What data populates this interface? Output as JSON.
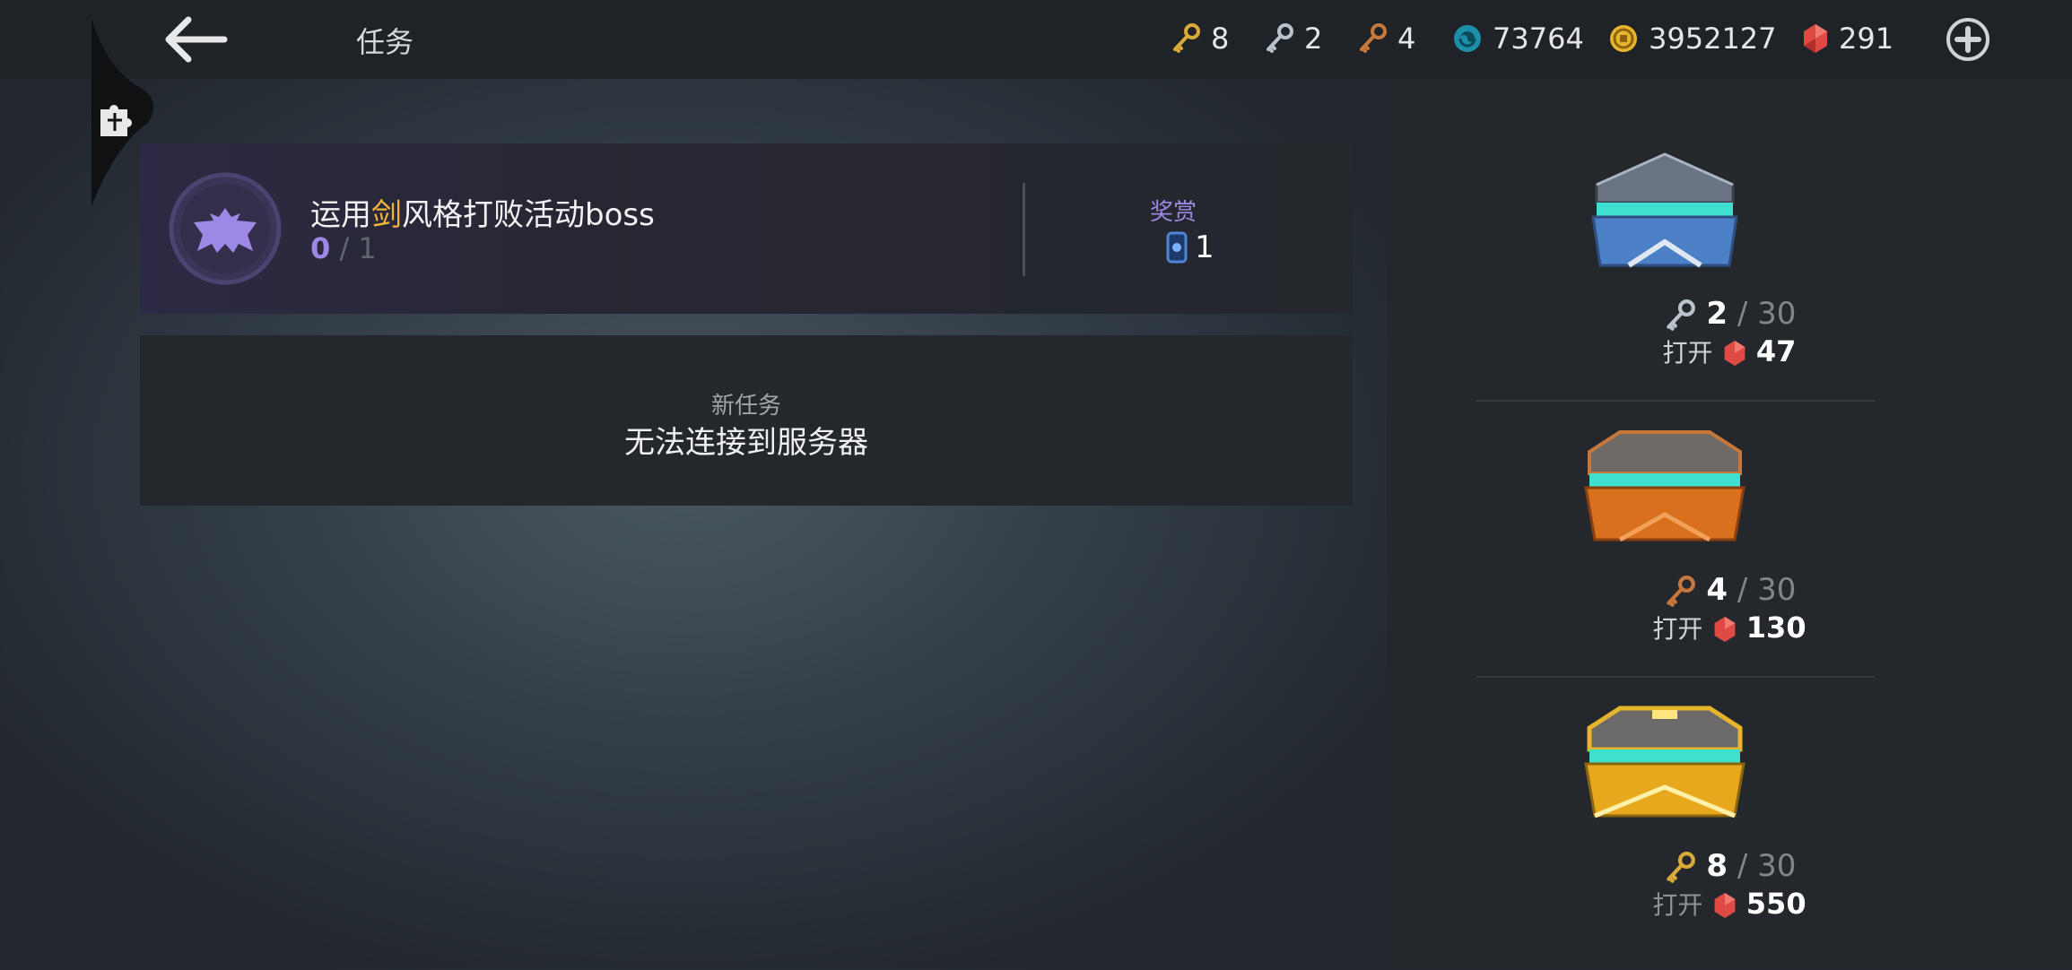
{
  "header": {
    "title": "任务"
  },
  "resources": {
    "gold_keys": "8",
    "silver_keys": "2",
    "bronze_keys": "4",
    "energy": "73764",
    "coins": "3952127",
    "gems": "291"
  },
  "quest": {
    "title_before": "运用",
    "title_highlight": "剑",
    "title_after": "风格打败活动boss",
    "progress_current": "0",
    "progress_rest": " / 1",
    "reward_label": "奖赏",
    "reward_value": "1"
  },
  "new_quest": {
    "label": "新任务",
    "message": "无法连接到服务器"
  },
  "chests": [
    {
      "tier": "silver",
      "keys": "2",
      "max": "30",
      "open_label": "打开",
      "cost": "47"
    },
    {
      "tier": "bronze",
      "keys": "4",
      "max": "30",
      "open_label": "打开",
      "cost": "130"
    },
    {
      "tier": "gold",
      "keys": "8",
      "max": "30",
      "open_label": "打开",
      "cost": "550"
    }
  ],
  "colors": {
    "highlight": "#f0b43a",
    "purple": "#9d88e6",
    "gold_key": "#d9a93a",
    "silver_key": "#b9c3cc",
    "bronze_key": "#c8773a",
    "gem": "#e04a45"
  }
}
